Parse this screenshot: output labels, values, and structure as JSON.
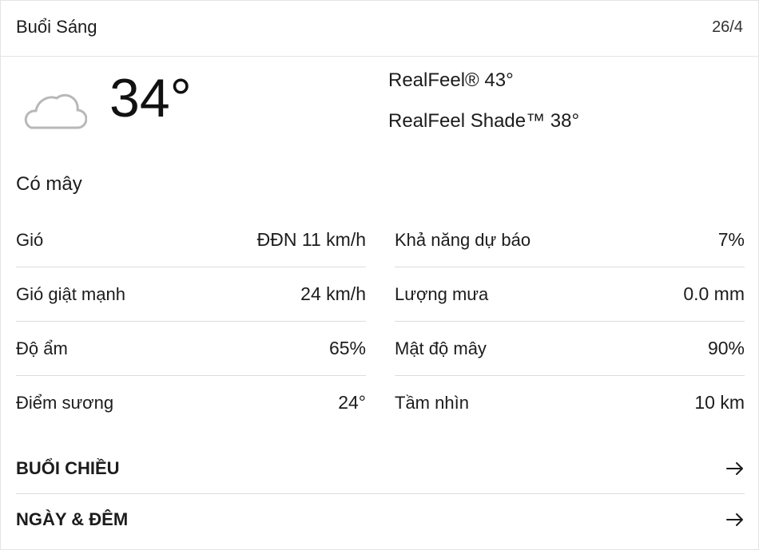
{
  "header": {
    "title": "Buổi Sáng",
    "date": "26/4"
  },
  "current": {
    "icon": "cloud-icon",
    "temperature": "34°",
    "realfeel": "RealFeel® 43°",
    "realfeel_shade": "RealFeel Shade™ 38°",
    "phrase": "Có mây"
  },
  "details_left": [
    {
      "label": "Gió",
      "value": "ĐĐN 11 km/h"
    },
    {
      "label": "Gió giật mạnh",
      "value": "24 km/h"
    },
    {
      "label": "Độ ẩm",
      "value": "65%"
    },
    {
      "label": "Điểm sương",
      "value": "24°"
    }
  ],
  "details_right": [
    {
      "label": "Khả năng dự báo",
      "value": "7%"
    },
    {
      "label": "Lượng mưa",
      "value": "0.0 mm"
    },
    {
      "label": "Mật độ mây",
      "value": "90%"
    },
    {
      "label": "Tầm nhìn",
      "value": "10 km"
    }
  ],
  "links": [
    {
      "label": "BUỔI CHIỀU",
      "icon": "arrow-right-icon"
    },
    {
      "label": "NGÀY & ĐÊM",
      "icon": "arrow-right-icon"
    }
  ]
}
